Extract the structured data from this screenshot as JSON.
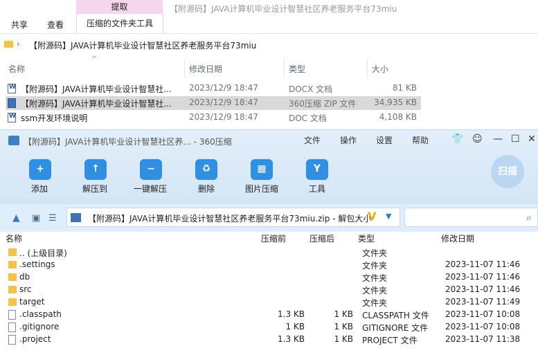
{
  "explorer": {
    "ribbon": {
      "context_tab": "提取",
      "tabs": [
        "共享",
        "查看",
        "压缩的文件夹工具"
      ]
    },
    "window_title": "【附源码】JAVA计算机毕业设计智慧社区养老服务平台73miu",
    "address": {
      "path": "【附源码】JAVA计算机毕业设计智慧社区养老服务平台73miu"
    },
    "columns": {
      "name": "名称",
      "date": "修改日期",
      "type": "类型",
      "size": "大小"
    },
    "files": [
      {
        "name": "【附源码】JAVA计算机毕业设计智慧社...",
        "date": "2023/12/9 18:47",
        "type": "DOCX 文档",
        "size": "81 KB",
        "icon": "word-doc-icon"
      },
      {
        "name": "【附源码】JAVA计算机毕业设计智慧社...",
        "date": "2023/12/9 18:47",
        "type": "360压缩 ZIP 文件",
        "size": "34,935 KB",
        "icon": "zip-icon"
      },
      {
        "name": "ssm开发环境说明",
        "date": "2023/12/9 18:47",
        "type": "DOC 文档",
        "size": "4,108 KB",
        "icon": "word-doc-icon"
      }
    ]
  },
  "zip": {
    "title": "【附源码】JAVA计算机毕业设计智慧社区养... - 360压缩",
    "menu": [
      "文件",
      "操作",
      "设置",
      "帮助"
    ],
    "toolbar": [
      "添加",
      "解压到",
      "一键解压",
      "删除",
      "图片压缩",
      "工具"
    ],
    "scan_label": "扫描",
    "path": "【附源码】JAVA计算机毕业设计智慧社区养老服务平台73miu.zip - 解包大小",
    "columns": {
      "name": "名称",
      "before": "压缩前",
      "after": "压缩后",
      "type": "类型",
      "modified": "修改日期"
    },
    "rows": [
      {
        "name": ".. (上级目录)",
        "before": "",
        "after": "",
        "type": "文件夹",
        "modified": "",
        "kind": "folder"
      },
      {
        "name": ".settings",
        "before": "",
        "after": "",
        "type": "文件夹",
        "modified": "2023-11-07 11:46",
        "kind": "folder"
      },
      {
        "name": "db",
        "before": "",
        "after": "",
        "type": "文件夹",
        "modified": "2023-11-07 11:46",
        "kind": "folder"
      },
      {
        "name": "src",
        "before": "",
        "after": "",
        "type": "文件夹",
        "modified": "2023-11-07 11:46",
        "kind": "folder"
      },
      {
        "name": "target",
        "before": "",
        "after": "",
        "type": "文件夹",
        "modified": "2023-11-07 11:49",
        "kind": "folder"
      },
      {
        "name": ".classpath",
        "before": "1.3 KB",
        "after": "1 KB",
        "type": "CLASSPATH 文件",
        "modified": "2023-11-07 10:08",
        "kind": "file"
      },
      {
        "name": ".gitignore",
        "before": "1 KB",
        "after": "1 KB",
        "type": "GITIGNORE 文件",
        "modified": "2023-11-07 10:08",
        "kind": "file"
      },
      {
        "name": ".project",
        "before": "1.3 KB",
        "after": "1 KB",
        "type": "PROJECT 文件",
        "modified": "2023-11-07 11:38",
        "kind": "file"
      }
    ]
  }
}
